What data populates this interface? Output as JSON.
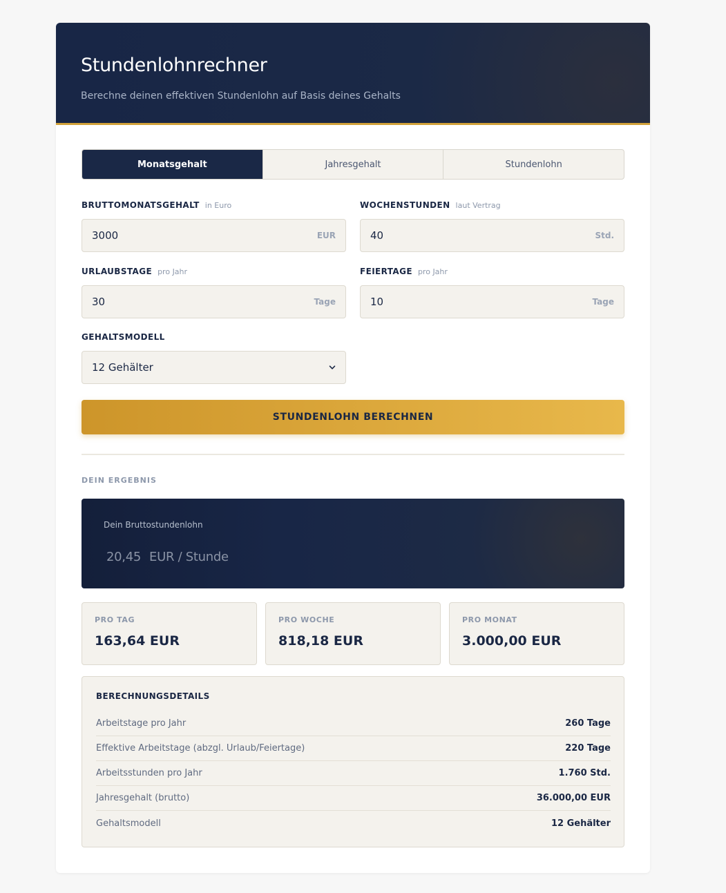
{
  "header": {
    "title": "Stundenlohnrechner",
    "subtitle": "Berechne deinen effektiven Stundenlohn auf Basis deines Gehalts"
  },
  "tabs": [
    {
      "label": "Monatsgehalt",
      "active": true
    },
    {
      "label": "Jahresgehalt",
      "active": false
    },
    {
      "label": "Stundenlohn",
      "active": false
    }
  ],
  "form": {
    "monthly_salary": {
      "label": "BRUTTOMONATSGEHALT",
      "hint": "in Euro",
      "value": "3000",
      "unit": "EUR"
    },
    "weekly_hours": {
      "label": "WOCHENSTUNDEN",
      "hint": "laut Vertrag",
      "value": "40",
      "unit": "Std."
    },
    "vacation_days": {
      "label": "URLAUBSTAGE",
      "hint": "pro Jahr",
      "value": "30",
      "unit": "Tage"
    },
    "holidays": {
      "label": "FEIERTAGE",
      "hint": "pro Jahr",
      "value": "10",
      "unit": "Tage"
    },
    "salary_model": {
      "label": "GEHALTSMODELL",
      "value": "12 Gehälter"
    }
  },
  "calculate_button": "STUNDENLOHN BERECHNEN",
  "result": {
    "section_label": "DEIN ERGEBNIS",
    "caption": "Dein Bruttostundenlohn",
    "value": "20,45",
    "unit": "EUR / Stunde"
  },
  "stats": [
    {
      "label": "PRO TAG",
      "value": "163,64 EUR"
    },
    {
      "label": "PRO WOCHE",
      "value": "818,18 EUR"
    },
    {
      "label": "PRO MONAT",
      "value": "3.000,00 EUR"
    }
  ],
  "details": {
    "title": "BERECHNUNGSDETAILS",
    "rows": [
      {
        "key": "Arbeitstage pro Jahr",
        "value": "260 Tage"
      },
      {
        "key": "Effektive Arbeitstage (abzgl. Urlaub/Feiertage)",
        "value": "220 Tage"
      },
      {
        "key": "Arbeitsstunden pro Jahr",
        "value": "1.760 Std."
      },
      {
        "key": "Jahresgehalt (brutto)",
        "value": "36.000,00 EUR"
      },
      {
        "key": "Gehaltsmodell",
        "value": "12 Gehälter"
      }
    ]
  },
  "colors": {
    "navy": "#1a2846",
    "gold": "#d2a23a",
    "panel": "#f4f2ed"
  }
}
